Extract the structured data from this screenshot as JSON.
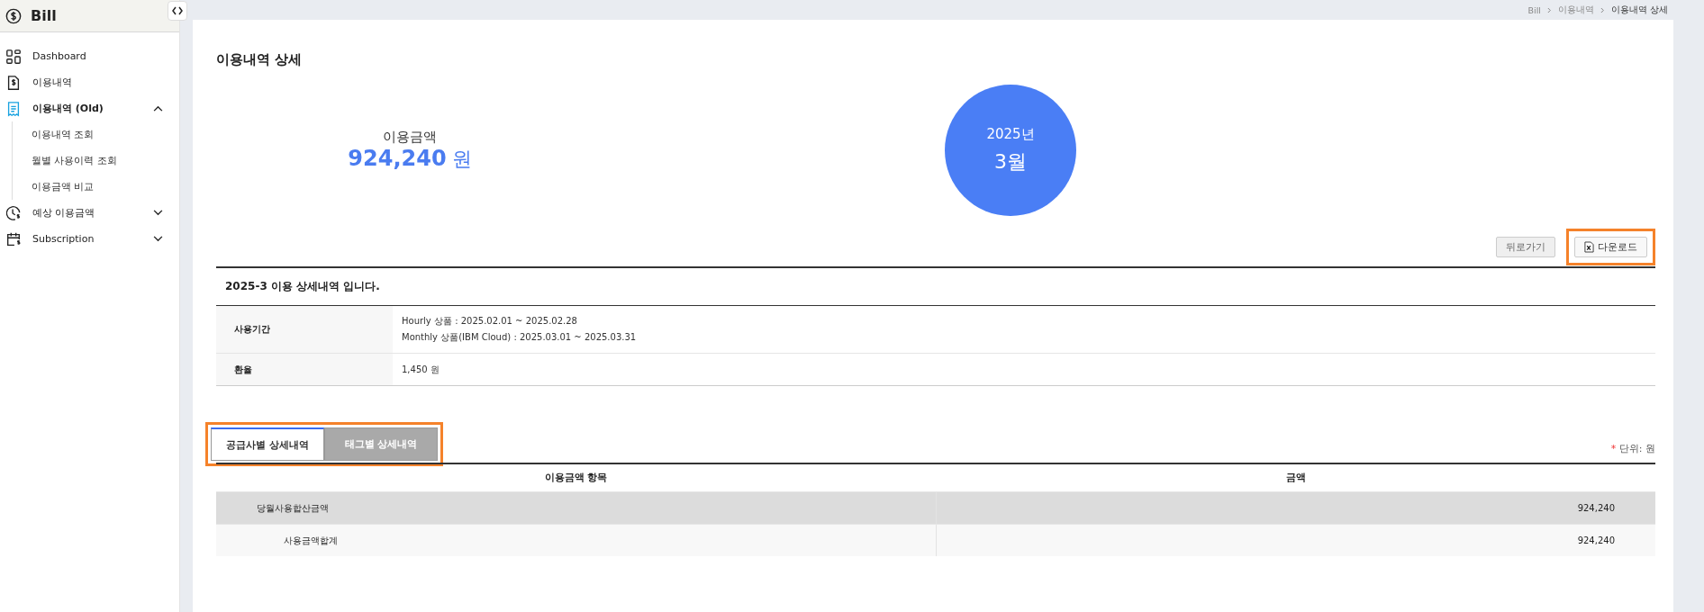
{
  "sidebar": {
    "brand": "Bill",
    "items": [
      {
        "label": "Dashboard",
        "active": false
      },
      {
        "label": "이용내역",
        "active": false
      },
      {
        "label": "이용내역 (Old)",
        "active": true,
        "expanded": true,
        "children": [
          {
            "label": "이용내역 조회"
          },
          {
            "label": "월별 사용이력 조회"
          },
          {
            "label": "이용금액 비교"
          }
        ]
      },
      {
        "label": "예상 이용금액",
        "active": false,
        "expanded": false
      },
      {
        "label": "Subscription",
        "active": false,
        "expanded": false
      }
    ]
  },
  "breadcrumb": [
    "Bill",
    "이용내역",
    "이용내역 상세"
  ],
  "page_title": "이용내역 상세",
  "summary": {
    "label": "이용금액",
    "amount": "924,240",
    "unit": "원",
    "year": "2025년",
    "month": "3월"
  },
  "buttons": [
    {
      "label": "뒤로가기",
      "kind": "plain",
      "highlighted": false
    },
    {
      "label": "다운로드",
      "kind": "excel",
      "highlighted": true
    }
  ],
  "detail": {
    "heading": "2025-3 이용 상세내역 입니다.",
    "rows": [
      {
        "label": "사용기간",
        "lines": [
          "Hourly 상품 : 2025.02.01 ~ 2025.02.28",
          "Monthly 상품(IBM Cloud) : 2025.03.01 ~ 2025.03.31"
        ]
      },
      {
        "label": "환율",
        "lines": [
          "1,450 원"
        ]
      }
    ]
  },
  "tabs": {
    "highlighted": true,
    "items": [
      {
        "label": "공급사별 상세내역",
        "selected": true
      },
      {
        "label": "태그별 상세내역",
        "selected": false
      }
    ]
  },
  "unit_note": {
    "mark": "*",
    "text": "단위: 원"
  },
  "table": {
    "columns": [
      "이용금액 항목",
      "금액"
    ],
    "rows": [
      {
        "item": "당월사용합산금액",
        "amount": "924,240",
        "children": [
          {
            "item": "사용금액합계",
            "amount": "924,240"
          }
        ]
      }
    ]
  }
}
